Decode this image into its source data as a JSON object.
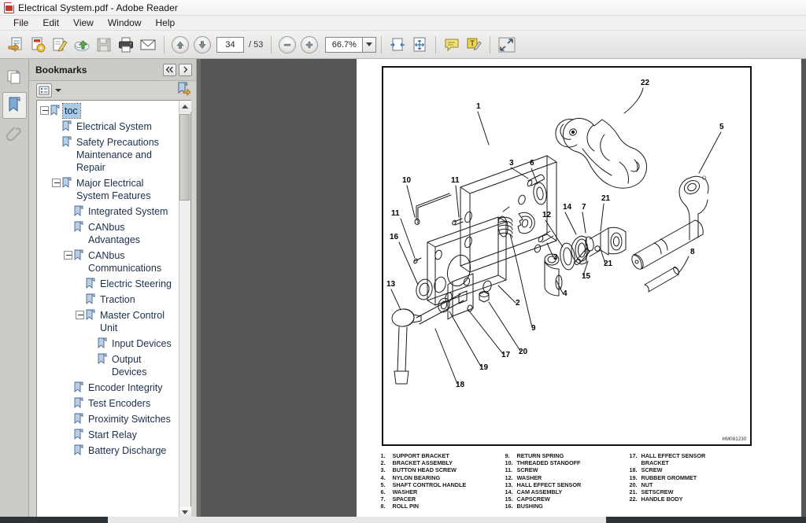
{
  "window": {
    "title": "Electrical System.pdf - Adobe Reader",
    "app_icon": "pdf-file-icon"
  },
  "menu": {
    "items": [
      {
        "label": "File"
      },
      {
        "label": "Edit"
      },
      {
        "label": "View"
      },
      {
        "label": "Window"
      },
      {
        "label": "Help"
      }
    ]
  },
  "toolbar": {
    "buttons": [
      {
        "name": "open-file-icon",
        "tip": "Open"
      },
      {
        "name": "create-pdf-icon",
        "tip": "Create PDF"
      },
      {
        "name": "sign-icon",
        "tip": "Sign"
      },
      {
        "name": "upload-cloud-icon",
        "tip": "Send files"
      },
      {
        "name": "save-icon",
        "tip": "Save"
      },
      {
        "name": "print-icon",
        "tip": "Print"
      },
      {
        "name": "email-icon",
        "tip": "Email"
      }
    ],
    "prev_page_icon": "arrow-up-icon",
    "next_page_icon": "arrow-down-icon",
    "page_current": "34",
    "page_total": "/ 53",
    "zoom_out_icon": "minus-icon",
    "zoom_in_icon": "plus-icon",
    "zoom_value": "66.7%",
    "zoom_dropdown_icon": "chevron-down-icon",
    "right_buttons": [
      {
        "name": "fit-width-icon"
      },
      {
        "name": "fit-page-icon"
      },
      {
        "name": "sticky-note-icon"
      },
      {
        "name": "highlight-text-icon"
      },
      {
        "name": "fullscreen-icon"
      }
    ]
  },
  "rail": {
    "items": [
      {
        "name": "page-thumbnails-icon",
        "label": "Page Thumbnails",
        "active": false
      },
      {
        "name": "bookmarks-icon",
        "label": "Bookmarks",
        "active": true
      },
      {
        "name": "attachments-icon",
        "label": "Attachments",
        "active": false
      }
    ]
  },
  "bookmarks_panel": {
    "title": "Bookmarks",
    "collapse_icon": "double-chevron-left-icon",
    "expand_icon": "chevron-right-icon",
    "options_icon": "options-list-icon",
    "options_caret": "caret-down-icon",
    "new_bookmark_icon": "new-bookmark-icon",
    "scroll_up_icon": "chevron-up-icon",
    "scroll_down_icon": "chevron-down-icon",
    "items": [
      {
        "label": "toc",
        "level": 0,
        "expander": "minus",
        "selected": true
      },
      {
        "label": "Electrical System",
        "level": 1,
        "expander": "none",
        "selected": false
      },
      {
        "label": "Safety Precautions Maintenance and Repair",
        "level": 1,
        "expander": "none",
        "selected": false
      },
      {
        "label": "Major Electrical System Features",
        "level": 1,
        "expander": "minus",
        "selected": false
      },
      {
        "label": "Integrated System",
        "level": 2,
        "expander": "none",
        "selected": false
      },
      {
        "label": "CANbus Advantages",
        "level": 2,
        "expander": "none",
        "selected": false
      },
      {
        "label": "CANbus Communications",
        "level": 2,
        "expander": "minus",
        "selected": false
      },
      {
        "label": "Electric Steering",
        "level": 3,
        "expander": "none",
        "selected": false
      },
      {
        "label": "Traction",
        "level": 3,
        "expander": "none",
        "selected": false
      },
      {
        "label": "Master Control Unit",
        "level": 3,
        "expander": "minus",
        "selected": false
      },
      {
        "label": "Input Devices",
        "level": 4,
        "expander": "none",
        "selected": false
      },
      {
        "label": "Output Devices",
        "level": 4,
        "expander": "none",
        "selected": false
      },
      {
        "label": "Encoder Integrity",
        "level": 2,
        "expander": "none",
        "selected": false
      },
      {
        "label": "Test Encoders",
        "level": 2,
        "expander": "none",
        "selected": false
      },
      {
        "label": "Proximity Switches",
        "level": 2,
        "expander": "none",
        "selected": false
      },
      {
        "label": "Start Relay",
        "level": 2,
        "expander": "none",
        "selected": false
      },
      {
        "label": "Battery Discharge",
        "level": 2,
        "expander": "none",
        "selected": false
      }
    ]
  },
  "document": {
    "drawing_code": "HM081230",
    "figure_name": "control-handle-exploded-assembly-diagram",
    "callouts": [
      "1",
      "2",
      "3",
      "3",
      "4",
      "5",
      "6",
      "7",
      "8",
      "9",
      "10",
      "11",
      "11",
      "12",
      "13",
      "14",
      "15",
      "16",
      "17",
      "18",
      "19",
      "20",
      "21",
      "21",
      "22"
    ],
    "parts_list": {
      "column1": [
        {
          "num": "1.",
          "name": "SUPPORT BRACKET"
        },
        {
          "num": "2.",
          "name": "BRACKET ASSEMBLY"
        },
        {
          "num": "3.",
          "name": "BUTTON HEAD SCREW"
        },
        {
          "num": "4.",
          "name": "NYLON BEARING"
        },
        {
          "num": "5.",
          "name": "SHAFT CONTROL HANDLE"
        },
        {
          "num": "6.",
          "name": "WASHER"
        },
        {
          "num": "7.",
          "name": "SPACER"
        },
        {
          "num": "8.",
          "name": "ROLL PIN"
        }
      ],
      "column2": [
        {
          "num": "9.",
          "name": "RETURN SPRING"
        },
        {
          "num": "10.",
          "name": "THREADED STANDOFF"
        },
        {
          "num": "11.",
          "name": "SCREW"
        },
        {
          "num": "12.",
          "name": "WASHER"
        },
        {
          "num": "13.",
          "name": "HALL EFFECT SENSOR"
        },
        {
          "num": "14.",
          "name": "CAM ASSEMBLY"
        },
        {
          "num": "15.",
          "name": "CAPSCREW"
        },
        {
          "num": "16.",
          "name": "BUSHING"
        }
      ],
      "column3": [
        {
          "num": "17.",
          "name": "HALL EFFECT SENSOR",
          "cont": "BRACKET"
        },
        {
          "num": "18.",
          "name": "SCREW"
        },
        {
          "num": "19.",
          "name": "RUBBER GROMMET"
        },
        {
          "num": "20.",
          "name": "NUT"
        },
        {
          "num": "21.",
          "name": "SETSCREW"
        },
        {
          "num": "22.",
          "name": "HANDLE BODY"
        }
      ]
    }
  },
  "colors": {
    "selection_blue": "#a8cbe8",
    "bookmark_text": "#1b2f4a",
    "viewport_gray": "#555555",
    "chrome_gray": "#d4d2cf"
  }
}
